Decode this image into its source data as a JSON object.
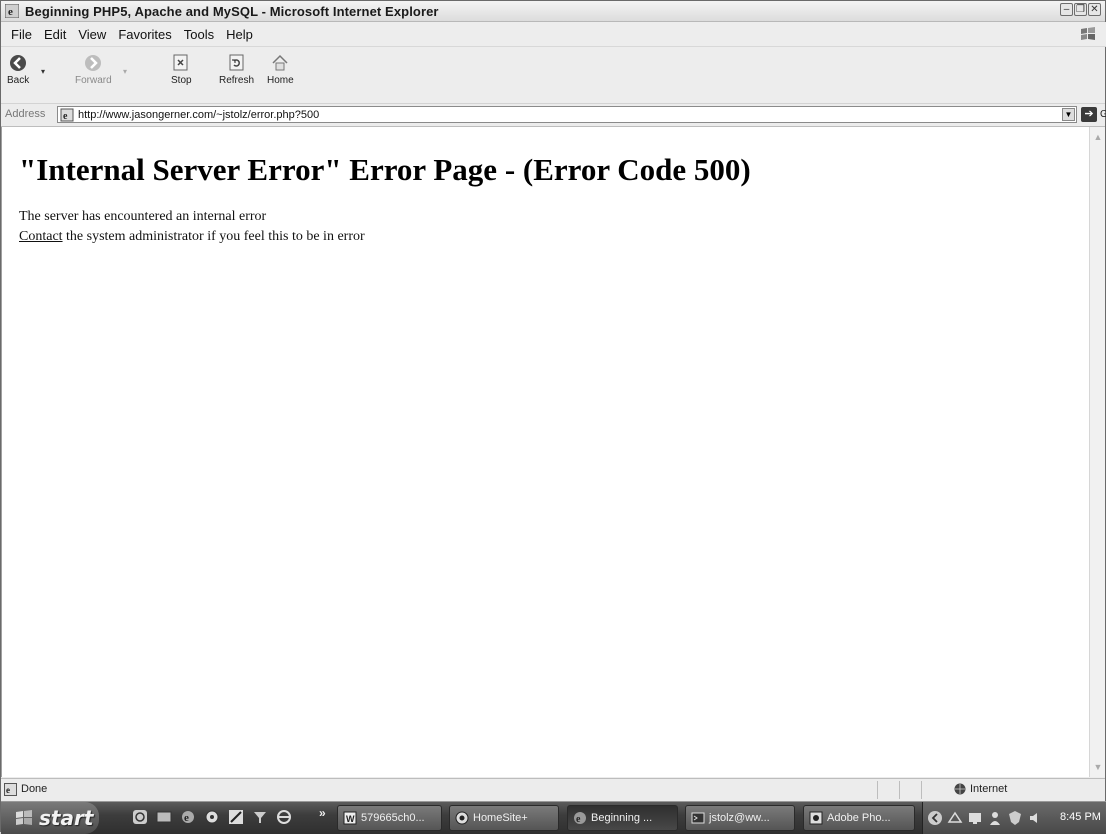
{
  "window": {
    "title": "Beginning PHP5, Apache and MySQL - Microsoft Internet Explorer"
  },
  "menu": {
    "items": [
      "File",
      "Edit",
      "View",
      "Favorites",
      "Tools",
      "Help"
    ]
  },
  "toolbar": {
    "back": "Back",
    "forward": "Forward",
    "stop": "Stop",
    "refresh": "Refresh",
    "home": "Home"
  },
  "address": {
    "label": "Address",
    "url": "http://www.jasongerner.com/~jstolz/error.php?500",
    "go": "Go"
  },
  "page": {
    "heading": "\"Internal Server Error\" Error Page - (Error Code 500)",
    "line1": "The server has encountered an internal error",
    "contact_link": "Contact",
    "line2_rest": " the system administrator if you feel this to be in error"
  },
  "status": {
    "text": "Done",
    "zone": "Internet"
  },
  "taskbar": {
    "start": "start",
    "more": "»",
    "tasks": [
      "579665ch0...",
      "HomeSite+",
      "Beginning ...",
      "jstolz@ww...",
      "Adobe Pho..."
    ],
    "clock": "8:45 PM"
  }
}
